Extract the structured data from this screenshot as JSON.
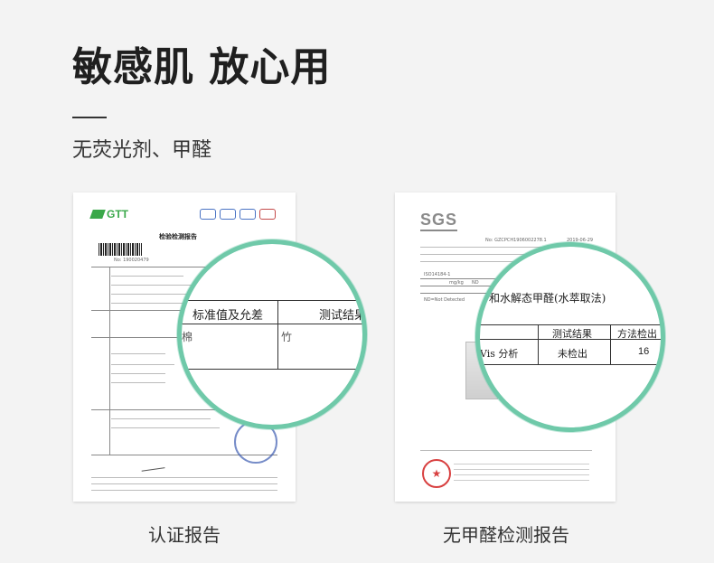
{
  "header": {
    "title": "敏感肌 放心用",
    "subtitle": "无荧光剂、甲醛"
  },
  "left_doc": {
    "logo": "GTT",
    "report_title": "检验检测报告",
    "report_no": "No: 190020479",
    "magnifier": {
      "col1_header": "标准值及允差",
      "col2_header": "测试结果",
      "cell1": "棉",
      "cell2": "竹"
    },
    "caption": "认证报告"
  },
  "right_doc": {
    "logo": "SGS",
    "report_no": "No: GZCPCH1906002278.1",
    "date": "2019-06-29",
    "unit": "mg/kg",
    "standard": "ISO14184-1",
    "result_small": "ND",
    "note": "ND=Not Detected",
    "magnifier": {
      "title": "和水解态甲醛(水萃取法)",
      "col1_header": "测试结果",
      "col2_header": "方法检出",
      "row_label": "Vis 分析",
      "row_result": "未检出",
      "row_value": "16"
    },
    "caption": "无甲醛检测报告"
  },
  "colors": {
    "accent": "#6fc9a9",
    "gtt_green": "#3aa84a",
    "sgs_gray": "#8a8a8a",
    "stamp_red": "#d84040",
    "stamp_blue": "#3c5bb0"
  }
}
